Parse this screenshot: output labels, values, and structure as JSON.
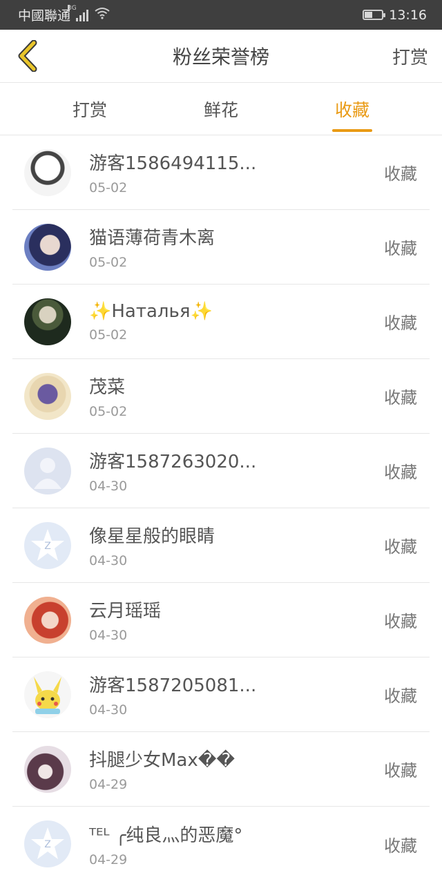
{
  "status_bar": {
    "carrier": "中國聯通",
    "network": "3G",
    "time": "13:16"
  },
  "header": {
    "back_icon": "chevron-left-icon",
    "back_color": "#e9c52a",
    "title": "粉丝荣誉榜",
    "action": "打赏"
  },
  "tabs": [
    {
      "label": "打赏",
      "active": false
    },
    {
      "label": "鲜花",
      "active": false
    },
    {
      "label": "收藏",
      "active": true
    }
  ],
  "accent_color": "#e99a14",
  "rows": [
    {
      "name": "游客1586494115...",
      "date": "05-02",
      "tag": "收藏",
      "avatar": "cartoon-character-avatar"
    },
    {
      "name": "猫语薄荷青木离",
      "date": "05-02",
      "tag": "收藏",
      "avatar": "photo-avatar"
    },
    {
      "name": "✨Наталья✨",
      "date": "05-02",
      "tag": "收藏",
      "avatar": "photo-avatar"
    },
    {
      "name": "茂菜",
      "date": "05-02",
      "tag": "收藏",
      "avatar": "anime-avatar"
    },
    {
      "name": "游客1587263020...",
      "date": "04-30",
      "tag": "收藏",
      "avatar": "default-person-avatar"
    },
    {
      "name": "像星星般的眼睛",
      "date": "04-30",
      "tag": "收藏",
      "avatar": "default-star-avatar"
    },
    {
      "name": "云月瑶瑶",
      "date": "04-30",
      "tag": "收藏",
      "avatar": "anime-avatar"
    },
    {
      "name": "游客1587205081...",
      "date": "04-30",
      "tag": "收藏",
      "avatar": "pikachu-avatar"
    },
    {
      "name": "抖腿少女Max��",
      "date": "04-29",
      "tag": "收藏",
      "avatar": "photo-avatar"
    },
    {
      "name": "ᵀᴱᴸ ╭纯良灬的恶魔°",
      "date": "04-29",
      "tag": "收藏",
      "avatar": "default-star-avatar"
    }
  ]
}
